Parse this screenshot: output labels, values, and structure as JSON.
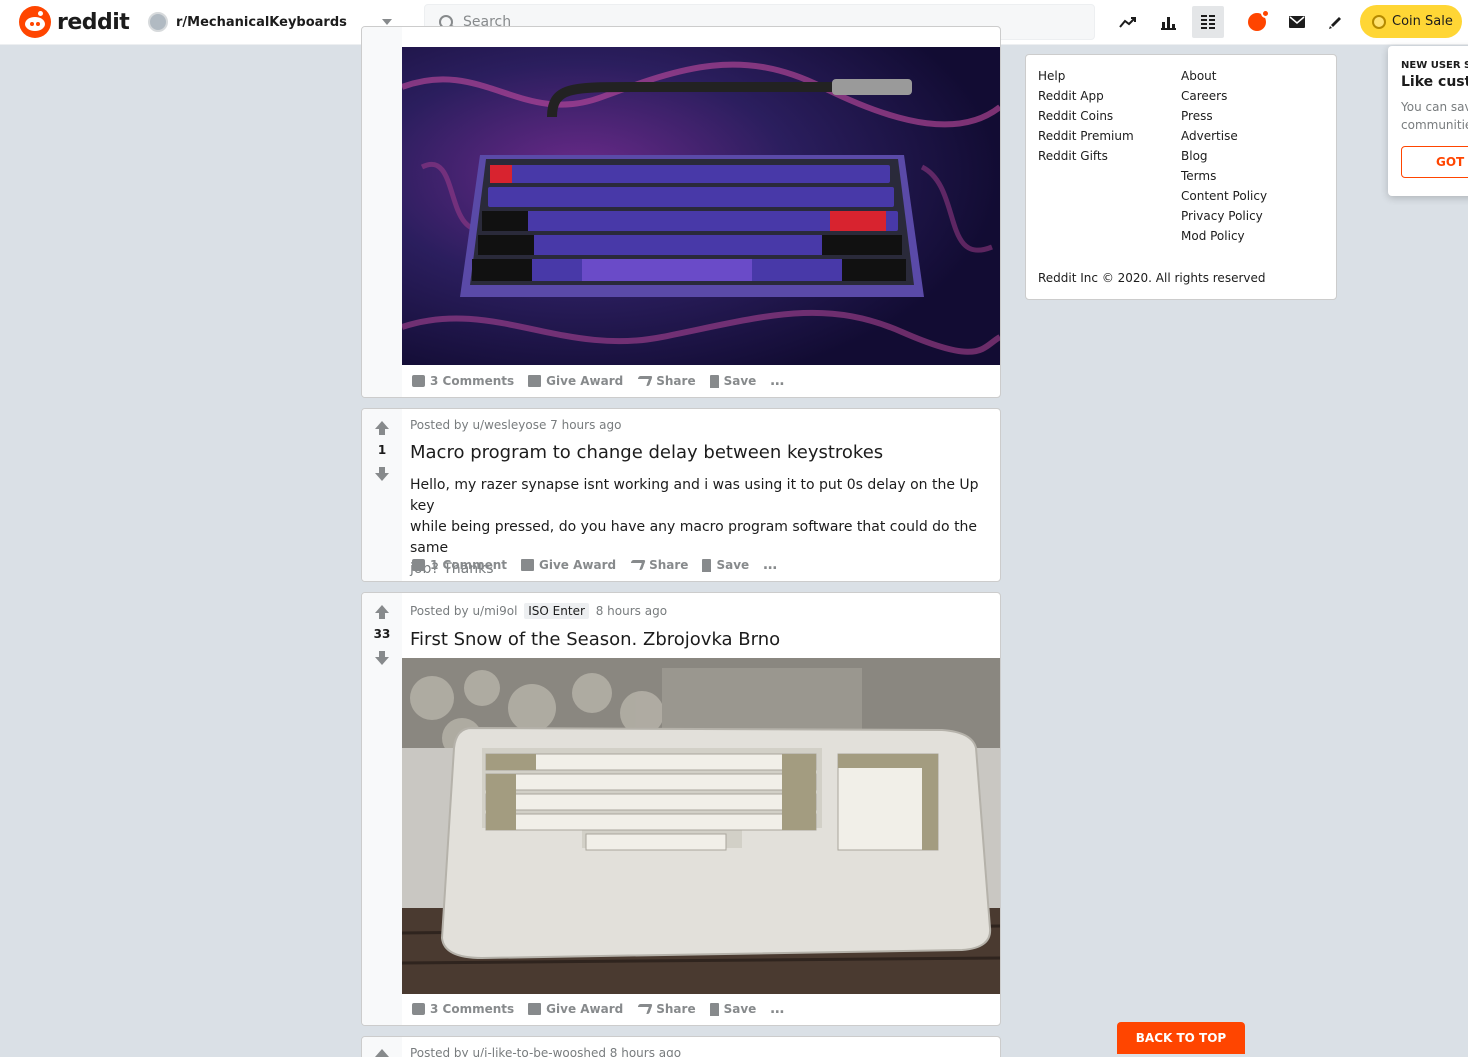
{
  "header": {
    "logo_text": "reddit",
    "community": "r/MechanicalKeyboards",
    "search_placeholder": "Search",
    "coin_sale_label": "Coin Sale",
    "icons": [
      "trending-icon",
      "stats-icon",
      "listing-view-icon",
      "chat-icon",
      "mail-icon",
      "pencil-icon"
    ]
  },
  "posts": [
    {
      "comments": "3 Comments",
      "award": "Give Award",
      "share": "Share",
      "save": "Save",
      "more": "…"
    },
    {
      "meta": "Posted by u/wesleyose 7 hours ago",
      "score": "1",
      "title": "Macro program to change delay between keystrokes",
      "body_line1": "Hello, my razer synapse isnt working and i was using it to put 0s delay on the Up key",
      "body_line2": "while being pressed, do you have any macro program software that could do the same",
      "body_line3": "job? Thanks",
      "comments": "1 Comment",
      "award": "Give Award",
      "share": "Share",
      "save": "Save",
      "more": "…"
    },
    {
      "meta_prefix": "Posted by u/mi9ol",
      "flair": "ISO Enter",
      "meta_suffix": "8 hours ago",
      "score": "33",
      "title": "First Snow of the Season. Zbrojovka Brno",
      "comments": "3 Comments",
      "award": "Give Award",
      "share": "Share",
      "save": "Save",
      "more": "…"
    },
    {
      "meta": "Posted by u/i-like-to-be-wooshed 8 hours ago"
    }
  ],
  "sidebar": {
    "col1": [
      "Help",
      "Reddit App",
      "Reddit Coins",
      "Reddit Premium",
      "Reddit Gifts"
    ],
    "col2": [
      "About",
      "Careers",
      "Press",
      "Advertise",
      "Blog",
      "Terms",
      "Content Policy",
      "Privacy Policy",
      "Mod Policy"
    ],
    "copyright": "Reddit Inc © 2020. All rights reserved"
  },
  "popover": {
    "kicker": "NEW USER SI",
    "title": "Like custom",
    "body_line1": "You can save",
    "body_line2": "communities",
    "button": "GOT I"
  },
  "back_to_top": "BACK TO TOP",
  "colors": {
    "brand": "#ff4500",
    "coin": "#ffd635",
    "page_bg": "#dae0e6"
  }
}
